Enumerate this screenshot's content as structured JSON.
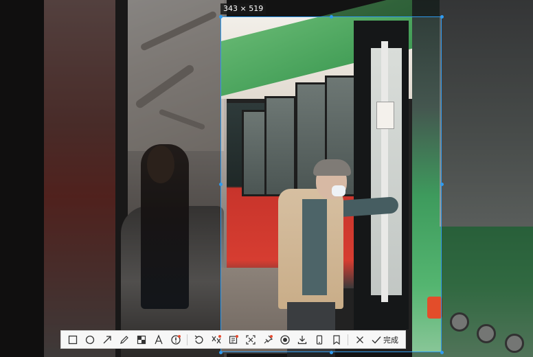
{
  "selection": {
    "size_label": "343 × 519"
  },
  "toolbar": {
    "tools": [
      {
        "name": "rectangle-tool-icon"
      },
      {
        "name": "ellipse-tool-icon"
      },
      {
        "name": "arrow-tool-icon"
      },
      {
        "name": "pen-tool-icon"
      },
      {
        "name": "mosaic-tool-icon"
      },
      {
        "name": "text-tool-icon"
      },
      {
        "name": "number-marker-tool-icon"
      },
      {
        "name": "undo-icon"
      },
      {
        "name": "translate-icon"
      },
      {
        "name": "ocr-icon"
      },
      {
        "name": "scroll-capture-icon"
      },
      {
        "name": "pin-icon"
      },
      {
        "name": "record-icon"
      },
      {
        "name": "download-icon"
      },
      {
        "name": "save-to-phone-icon"
      },
      {
        "name": "bookmark-icon"
      },
      {
        "name": "cancel-icon"
      }
    ],
    "done_label": "完成"
  },
  "colors": {
    "selection_border": "#2f9bf0",
    "toolbar_bg": "#f7f7f7"
  }
}
